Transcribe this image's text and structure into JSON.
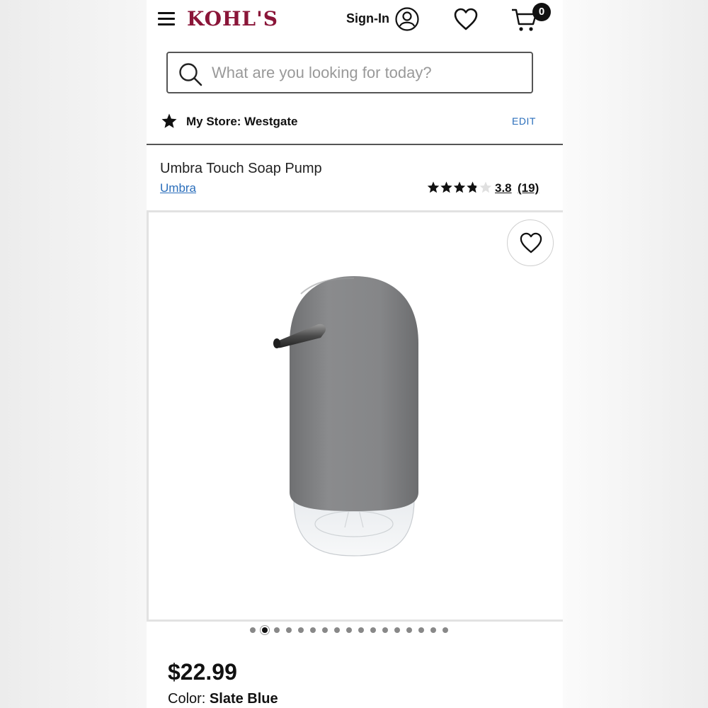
{
  "header": {
    "logo_text": "KOHL'S",
    "brand_color": "#8a1538",
    "signin_label": "Sign-In",
    "cart_count": "0",
    "icons": [
      "menu-icon",
      "user-icon",
      "heart-icon",
      "cart-icon"
    ]
  },
  "search": {
    "placeholder": "What are you looking for today?",
    "value": ""
  },
  "store": {
    "label": "My Store: Westgate",
    "edit_label": "EDIT"
  },
  "product": {
    "title": "Umbra Touch Soap Pump",
    "brand": "Umbra",
    "rating_value": "3.8",
    "rating_count": "(19)",
    "rating_fraction": 0.76,
    "price": "$22.99",
    "color_label": "Color:",
    "color_value": "Slate Blue"
  },
  "carousel": {
    "total_images": 17,
    "active_index": 1
  },
  "colors": {
    "link": "#2a6ebb",
    "accent": "#8a1538",
    "product_body": "#808183"
  }
}
